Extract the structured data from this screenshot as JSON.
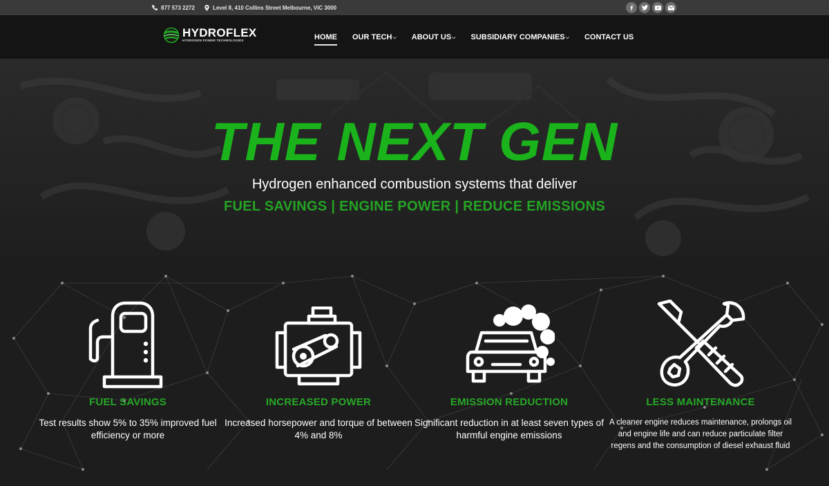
{
  "topbar": {
    "phone": "877 573 2272",
    "address": "Level 8, 410 Collins Street Melbourne, VIC 3000",
    "social_icons": [
      "facebook-icon",
      "twitter-icon",
      "youtube-icon",
      "email-icon"
    ]
  },
  "logo": {
    "brand": "HYDROFLEX",
    "tagline": "HYDROGEN POWER TECHNOLOGIES"
  },
  "nav": {
    "items": [
      {
        "label": "HOME",
        "active": true
      },
      {
        "label": "OUR TECH",
        "dropdown": true
      },
      {
        "label": "ABOUT US",
        "dropdown": true
      },
      {
        "label": "SUBSIDIARY COMPANIES",
        "dropdown": true
      },
      {
        "label": "CONTACT US"
      }
    ]
  },
  "hero": {
    "title": "THE NEXT GEN",
    "subtitle": "Hydrogen enhanced combustion systems that deliver",
    "tagline": "FUEL SAVINGS | ENGINE POWER | REDUCE EMISSIONS"
  },
  "features": [
    {
      "icon": "fuel-pump-icon",
      "title": "FUEL SAVINGS",
      "desc": "Test results show 5% to 35% improved fuel efficiency or more"
    },
    {
      "icon": "engine-icon",
      "title": "INCREASED POWER",
      "desc": "Increased horsepower and torque of between 4% and 8%"
    },
    {
      "icon": "car-emission-icon",
      "title": "EMISSION REDUCTION",
      "desc": "Significant reduction in at least seven types of harmful engine emissions"
    },
    {
      "icon": "tools-icon",
      "title": "LESS MAINTENANCE",
      "desc": "A cleaner engine reduces maintenance, prolongs oil and engine life and can reduce particulate filter regens and the consumption of diesel exhaust fluid"
    }
  ],
  "colors": {
    "accent_green": "#1bb31b",
    "nav_bg": "#141414",
    "topbar_bg": "#3a3a3a"
  }
}
